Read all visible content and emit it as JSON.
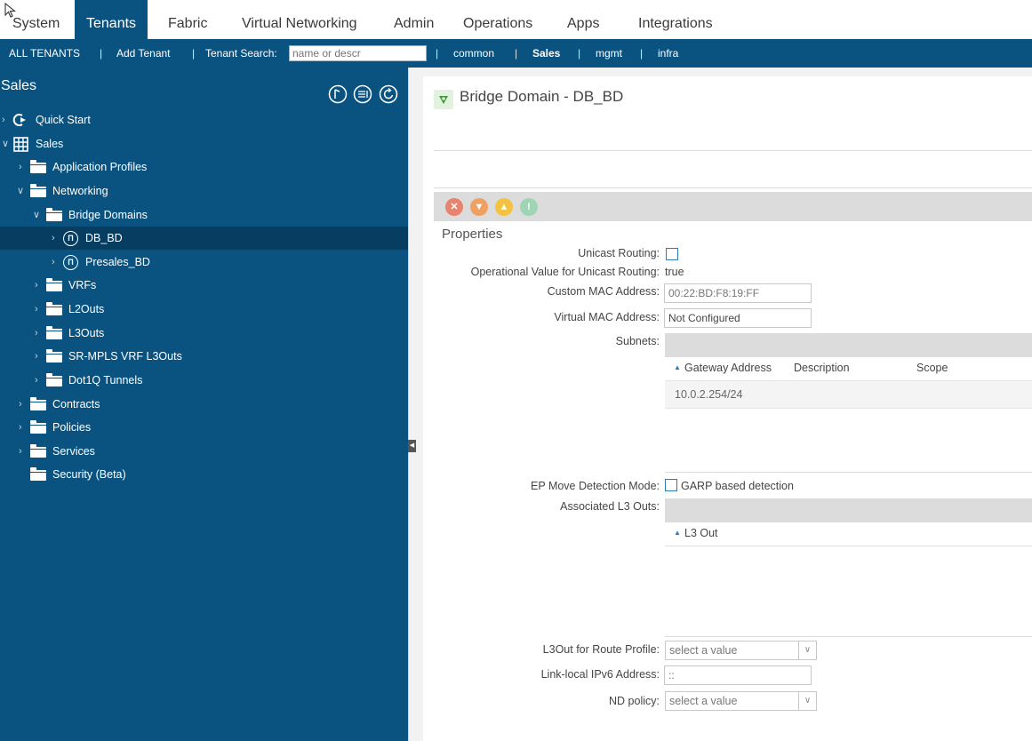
{
  "topnav": {
    "tabs": [
      "System",
      "Tenants",
      "Fabric",
      "Virtual Networking",
      "Admin",
      "Operations",
      "Apps",
      "Integrations"
    ],
    "active": "Tenants"
  },
  "tenantbar": {
    "all_tenants": "ALL TENANTS",
    "add_tenant": "Add Tenant",
    "search_label": "Tenant Search:",
    "search_placeholder": "name or descr",
    "tenants": [
      "common",
      "Sales",
      "mgmt",
      "infra"
    ]
  },
  "sidebar": {
    "title": "Sales",
    "quick_start": "Quick Start",
    "tenant": "Sales",
    "application_profiles": "Application Profiles",
    "networking": "Networking",
    "bridge_domains": "Bridge Domains",
    "db_bd": "DB_BD",
    "presales_bd": "Presales_BD",
    "vrfs": "VRFs",
    "l2outs": "L2Outs",
    "l3outs": "L3Outs",
    "sr_mpls": "SR-MPLS VRF L3Outs",
    "dot1q": "Dot1Q Tunnels",
    "contracts": "Contracts",
    "policies": "Policies",
    "services": "Services",
    "security": "Security (Beta)"
  },
  "main": {
    "title": "Bridge Domain - DB_BD",
    "properties_title": "Properties",
    "unicast_routing_label": "Unicast Routing:",
    "unicast_routing_checked": false,
    "op_unicast_label": "Operational Value for Unicast Routing:",
    "op_unicast_value": "true",
    "custom_mac_label": "Custom MAC Address:",
    "custom_mac_value": "00:22:BD:F8:19:FF",
    "virtual_mac_label": "Virtual MAC Address:",
    "virtual_mac_value": "Not Configured",
    "subnets_label": "Subnets:",
    "subnet_headers": [
      "Gateway Address",
      "Description",
      "Scope"
    ],
    "subnet_rows": [
      "10.0.2.254/24"
    ],
    "ep_move_label": "EP Move Detection Mode:",
    "ep_move_option": "GARP based detection",
    "assoc_l3outs_label": "Associated L3 Outs:",
    "l3out_header": "L3 Out",
    "l3out_route_profile_label": "L3Out for Route Profile:",
    "l3out_route_profile_value": "select a value",
    "link_local_label": "Link-local IPv6 Address:",
    "link_local_value": "::",
    "nd_policy_label": "ND policy:",
    "nd_policy_value": "select a value"
  },
  "colors": {
    "nav_blue": "#0a5380",
    "selected_row": "#063d60",
    "fault_critical": "#e8836f",
    "fault_major": "#f0a060",
    "fault_minor": "#f2c240",
    "fault_warning": "#9fd4b5",
    "bd_icon_green": "#3d9a3d"
  }
}
